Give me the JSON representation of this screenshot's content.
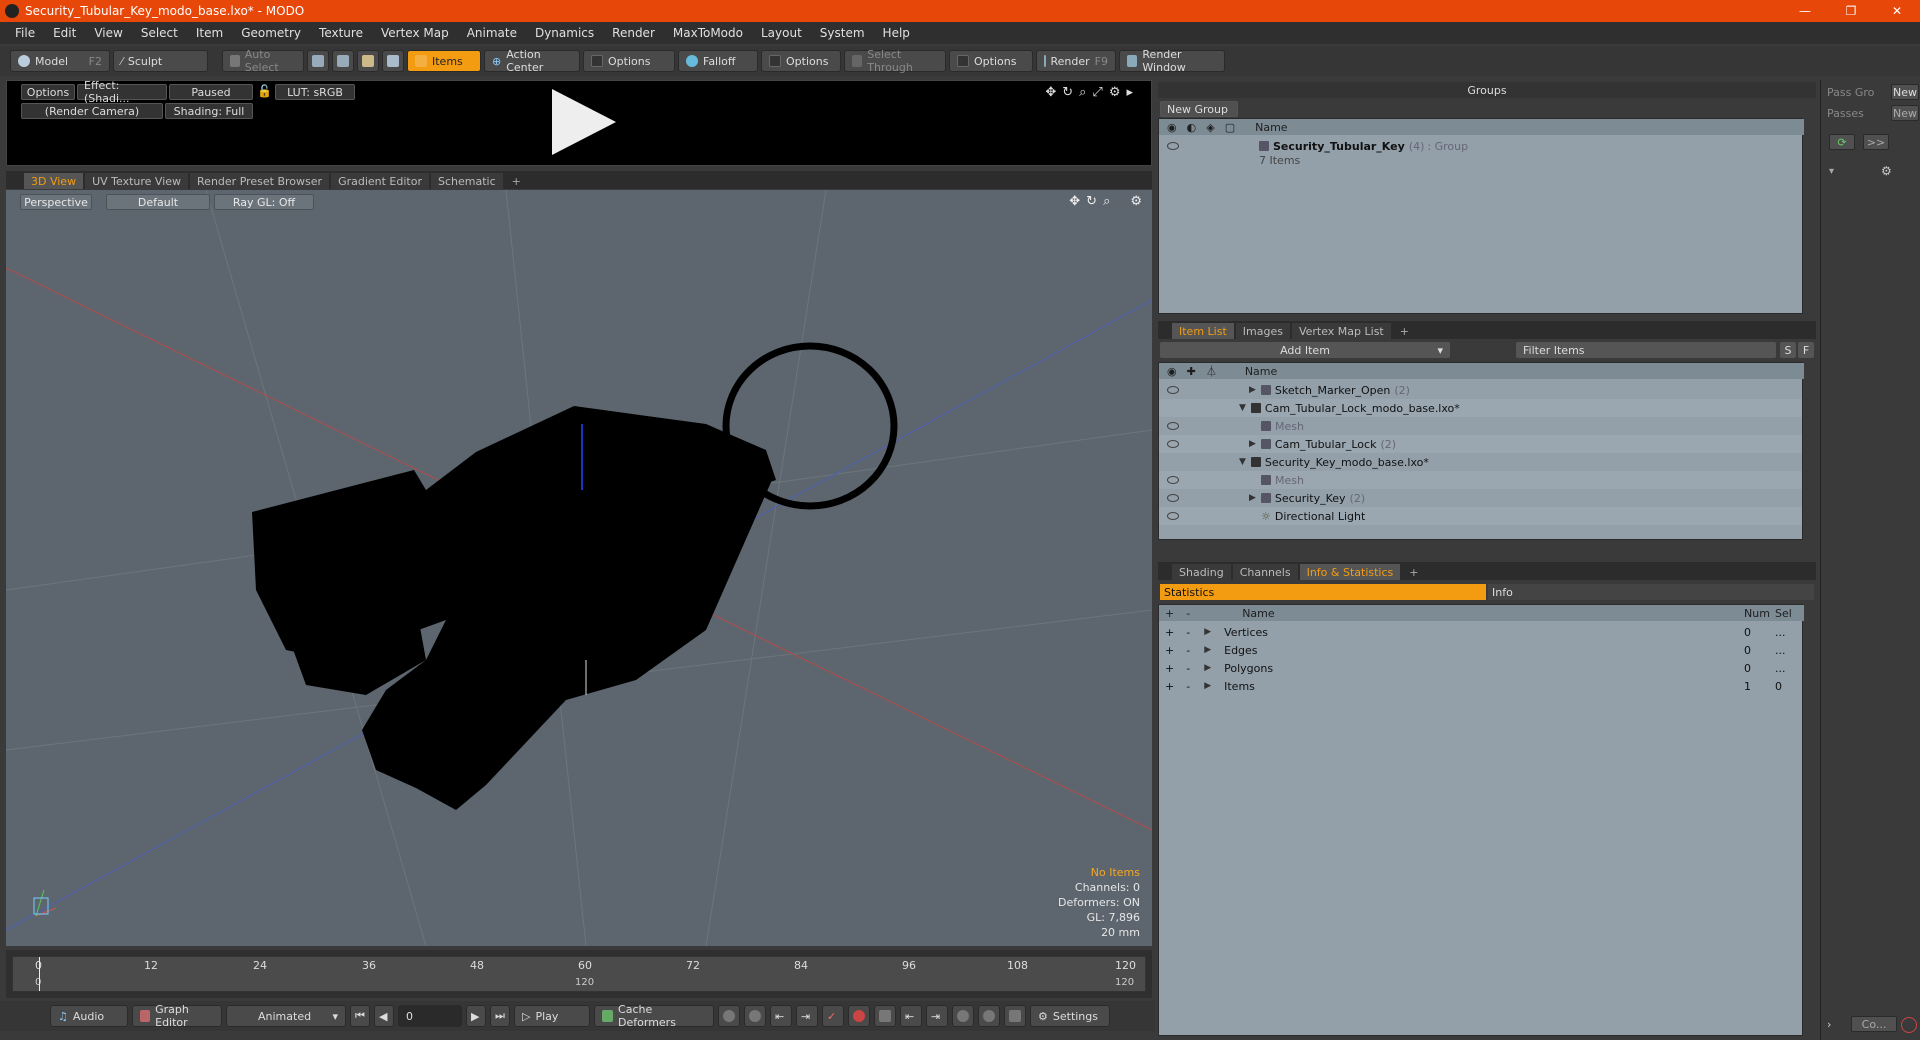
{
  "window": {
    "title": "Security_Tubular_Key_modo_base.lxo* - MODO",
    "minimize": "—",
    "maximize": "❐",
    "close": "✕"
  },
  "menu": [
    "File",
    "Edit",
    "View",
    "Select",
    "Item",
    "Geometry",
    "Texture",
    "Vertex Map",
    "Animate",
    "Dynamics",
    "Render",
    "MaxToModo",
    "Layout",
    "System",
    "Help"
  ],
  "toolbar": {
    "model": "Model",
    "model_key": "F2",
    "sculpt": "Sculpt",
    "auto_select": "Auto Select",
    "items": "Items",
    "action_center": "Action Center",
    "options1": "Options",
    "falloff": "Falloff",
    "options2": "Options",
    "select_through": "Select Through",
    "options3": "Options",
    "render": "Render",
    "render_key": "F9",
    "render_window": "Render Window"
  },
  "preview": {
    "options": "Options",
    "effect": "Effect: (Shadi...",
    "paused": "Paused",
    "lut": "LUT: sRGB",
    "camera": "(Render Camera)",
    "shading": "Shading: Full"
  },
  "viewport_tabs": [
    "3D View",
    "UV Texture View",
    "Render Preset Browser",
    "Gradient Editor",
    "Schematic",
    "+"
  ],
  "viewport": {
    "perspective": "Perspective",
    "default": "Default",
    "raygl": "Ray GL: Off",
    "info": {
      "no_items": "No Items",
      "channels": "Channels: 0",
      "deformers": "Deformers: ON",
      "gl": "GL: 7,896",
      "scale": "20 mm"
    }
  },
  "timeline": {
    "ticks": [
      "0",
      "12",
      "24",
      "36",
      "48",
      "60",
      "72",
      "84",
      "96",
      "108",
      "120"
    ],
    "sub_left": "0",
    "sub_mid": "120",
    "sub_right": "120"
  },
  "bottombar": {
    "audio": "Audio",
    "graph_editor": "Graph Editor",
    "animated": "Animated",
    "frame": "0",
    "play": "Play",
    "cache": "Cache Deformers",
    "settings": "Settings"
  },
  "groups": {
    "title": "Groups",
    "new_group": "New Group",
    "col_name": "Name",
    "group_name": "Security_Tubular_Key",
    "group_count": "(4)",
    "group_type": ": Group",
    "group_items": "7 Items"
  },
  "itemlist": {
    "tabs": [
      "Item List",
      "Images",
      "Vertex Map List",
      "+"
    ],
    "add_item": "Add Item",
    "filter": "Filter Items",
    "s": "S",
    "f": "F",
    "col_name": "Name",
    "rows": [
      {
        "label": "Sketch_Marker_Open",
        "count": "(2)"
      },
      {
        "label": "Cam_Tubular_Lock_modo_base.lxo*",
        "count": ""
      },
      {
        "label": "Mesh",
        "count": ""
      },
      {
        "label": "Cam_Tubular_Lock",
        "count": "(2)"
      },
      {
        "label": "Security_Key_modo_base.lxo*",
        "count": ""
      },
      {
        "label": "Mesh",
        "count": ""
      },
      {
        "label": "Security_Key",
        "count": "(2)"
      },
      {
        "label": "Directional Light",
        "count": ""
      }
    ]
  },
  "stats": {
    "tabs": [
      "Shading",
      "Channels",
      "Info & Statistics",
      "+"
    ],
    "statistics": "Statistics",
    "info": "Info",
    "col_name": "Name",
    "col_num": "Num",
    "col_sel": "Sel",
    "rows": [
      {
        "name": "Vertices",
        "num": "0",
        "sel": "..."
      },
      {
        "name": "Edges",
        "num": "0",
        "sel": "..."
      },
      {
        "name": "Polygons",
        "num": "0",
        "sel": "..."
      },
      {
        "name": "Items",
        "num": "1",
        "sel": "0"
      }
    ]
  },
  "rightstrip": {
    "pass_groups": "Pass Gro",
    "new1": "New",
    "passes": "Passes",
    "new2": "New",
    "more": ">>",
    "co": "Co..."
  },
  "colors": {
    "accent": "#f39c12",
    "titlebar": "#e8470a",
    "viewport": "#5d666e",
    "panel": "#93a0aa"
  }
}
